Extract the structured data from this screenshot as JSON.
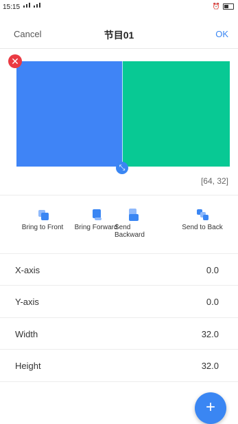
{
  "status": {
    "time": "15:15"
  },
  "header": {
    "cancel": "Cancel",
    "title": "节目01",
    "ok": "OK"
  },
  "canvas": {
    "coordinates": "[64, 32]",
    "left_color": "#3f84f6",
    "right_color": "#08c994"
  },
  "toolbar": {
    "items": [
      {
        "label": "Bring to Front",
        "icon": "bring-to-front-icon"
      },
      {
        "label": "Bring Forward",
        "icon": "bring-forward-icon"
      },
      {
        "label": "Send Backward",
        "icon": "send-backward-icon"
      },
      {
        "label": "Send to Back",
        "icon": "send-to-back-icon"
      }
    ]
  },
  "properties": [
    {
      "label": "X-axis",
      "value": "0.0"
    },
    {
      "label": "Y-axis",
      "value": "0.0"
    },
    {
      "label": "Width",
      "value": "32.0"
    },
    {
      "label": "Height",
      "value": "32.0"
    }
  ],
  "fab": {
    "label": "+"
  },
  "accent": "#3a86f3"
}
